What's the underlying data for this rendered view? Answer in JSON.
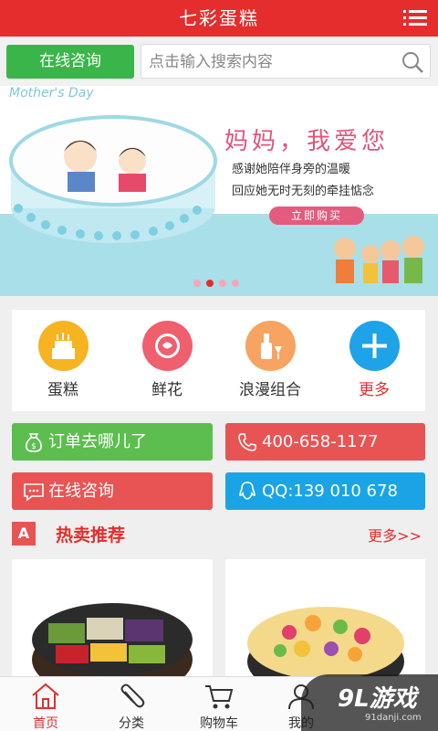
{
  "header": {
    "title": "七彩蛋糕",
    "menu_icon": "menu-icon"
  },
  "search": {
    "consult_label": "在线咨询",
    "placeholder": "点击输入搜索内容",
    "icon": "search-icon"
  },
  "banner": {
    "tag": "Mother's Day",
    "headline": "妈妈，我爱您",
    "line1": "感谢她陪伴身旁的温暖",
    "line2": "回应她无时无刻的牵挂惦念",
    "buy_label": "立即购买",
    "slide_count": 4,
    "active_slide": 2
  },
  "categories": [
    {
      "label": "蛋糕",
      "icon": "cake-icon",
      "color": "#f6b322"
    },
    {
      "label": "鲜花",
      "icon": "flower-icon",
      "color": "#ef5f6e"
    },
    {
      "label": "浪漫组合",
      "icon": "wine-icon",
      "color": "#f7a361"
    },
    {
      "label": "更多",
      "icon": "plus-icon",
      "color": "#1fa3e8"
    }
  ],
  "actions": {
    "order": {
      "label": "订单去哪儿了",
      "icon": "money-bag-icon"
    },
    "phone": {
      "label": "400-658-1177",
      "icon": "phone-icon"
    },
    "consult": {
      "label": "在线咨询",
      "icon": "chat-icon"
    },
    "qq": {
      "label": "QQ:139 010 678",
      "icon": "qq-icon"
    }
  },
  "hot": {
    "badge": "A",
    "title": "热卖推荐",
    "more": "更多>>"
  },
  "nav": [
    {
      "label": "首页",
      "icon": "home-icon",
      "active": true
    },
    {
      "label": "分类",
      "icon": "paperclip-icon",
      "active": false
    },
    {
      "label": "购物车",
      "icon": "cart-icon",
      "active": false
    },
    {
      "label": "我的",
      "icon": "user-icon",
      "active": false
    }
  ],
  "watermark": {
    "logo": "9L游戏",
    "site": "91danji.com"
  },
  "colors": {
    "brand": "#e52d2d",
    "green": "#5bbe4e",
    "red": "#e85454",
    "blue": "#1aa4e6"
  }
}
